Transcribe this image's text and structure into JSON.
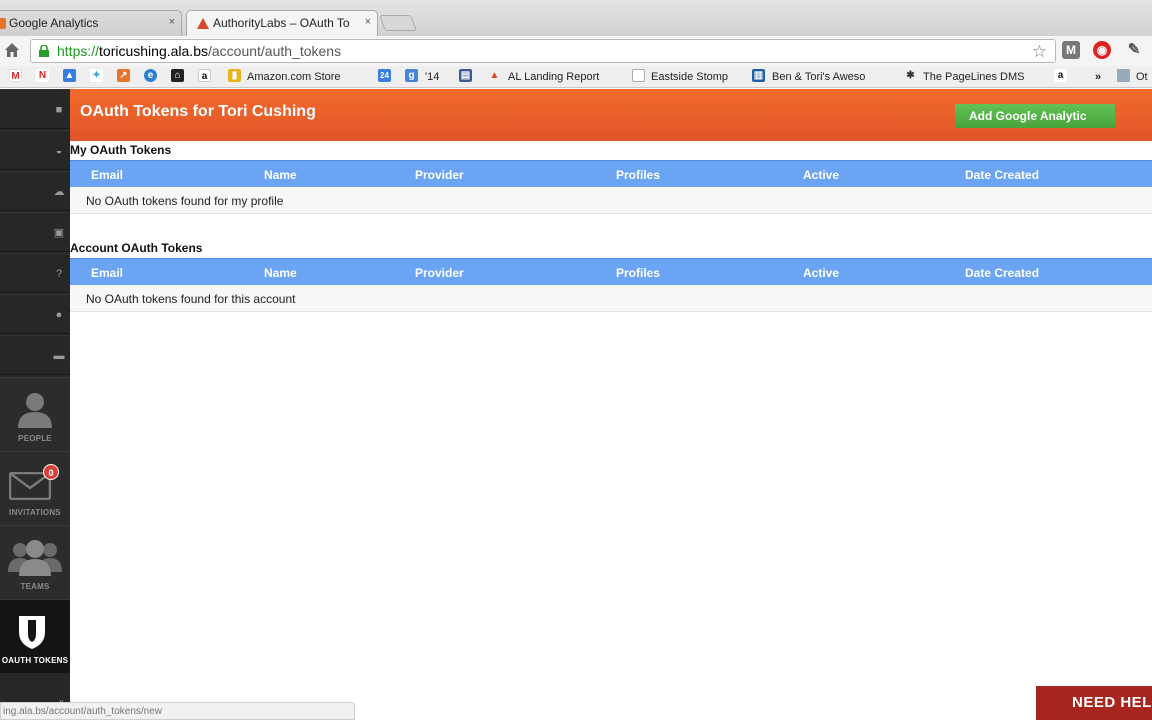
{
  "browser": {
    "tabs": [
      {
        "title": "Google Analytics",
        "close": "×"
      },
      {
        "title": "AuthorityLabs – OAuth To",
        "close": "×"
      }
    ],
    "url": {
      "scheme": "https://",
      "host": "toricushing.ala.bs",
      "path": "/account/auth_tokens"
    },
    "bookmarks": [
      "Amazon.com Store",
      "'14",
      "AL Landing Report",
      "Eastside Stomp",
      "Ben & Tori's Aweso",
      "The PageLines DMS",
      "»",
      "Ot"
    ],
    "status_url": "ing.ala.bs/account/auth_tokens/new"
  },
  "header": {
    "title": "OAuth Tokens for Tori Cushing",
    "add_button": "Add Google Analytic"
  },
  "sidebar": {
    "people": "PEOPLE",
    "invitations": "INVITATIONS",
    "invitations_badge": "0",
    "teams": "TEAMS",
    "oauth_tokens": "OAUTH TOKENS"
  },
  "columns": [
    "Email",
    "Name",
    "Provider",
    "Profiles",
    "Active",
    "Date Created"
  ],
  "my_tokens": {
    "title": "My OAuth Tokens",
    "empty": "No OAuth tokens found for my profile"
  },
  "account_tokens": {
    "title": "Account OAuth Tokens",
    "empty": "No OAuth tokens found for this account"
  },
  "help": "NEED HELP",
  "colors": {
    "header": "#e85f2a",
    "table_header": "#6aa4f2",
    "add_button": "#52b246",
    "sidebar": "#272727"
  }
}
